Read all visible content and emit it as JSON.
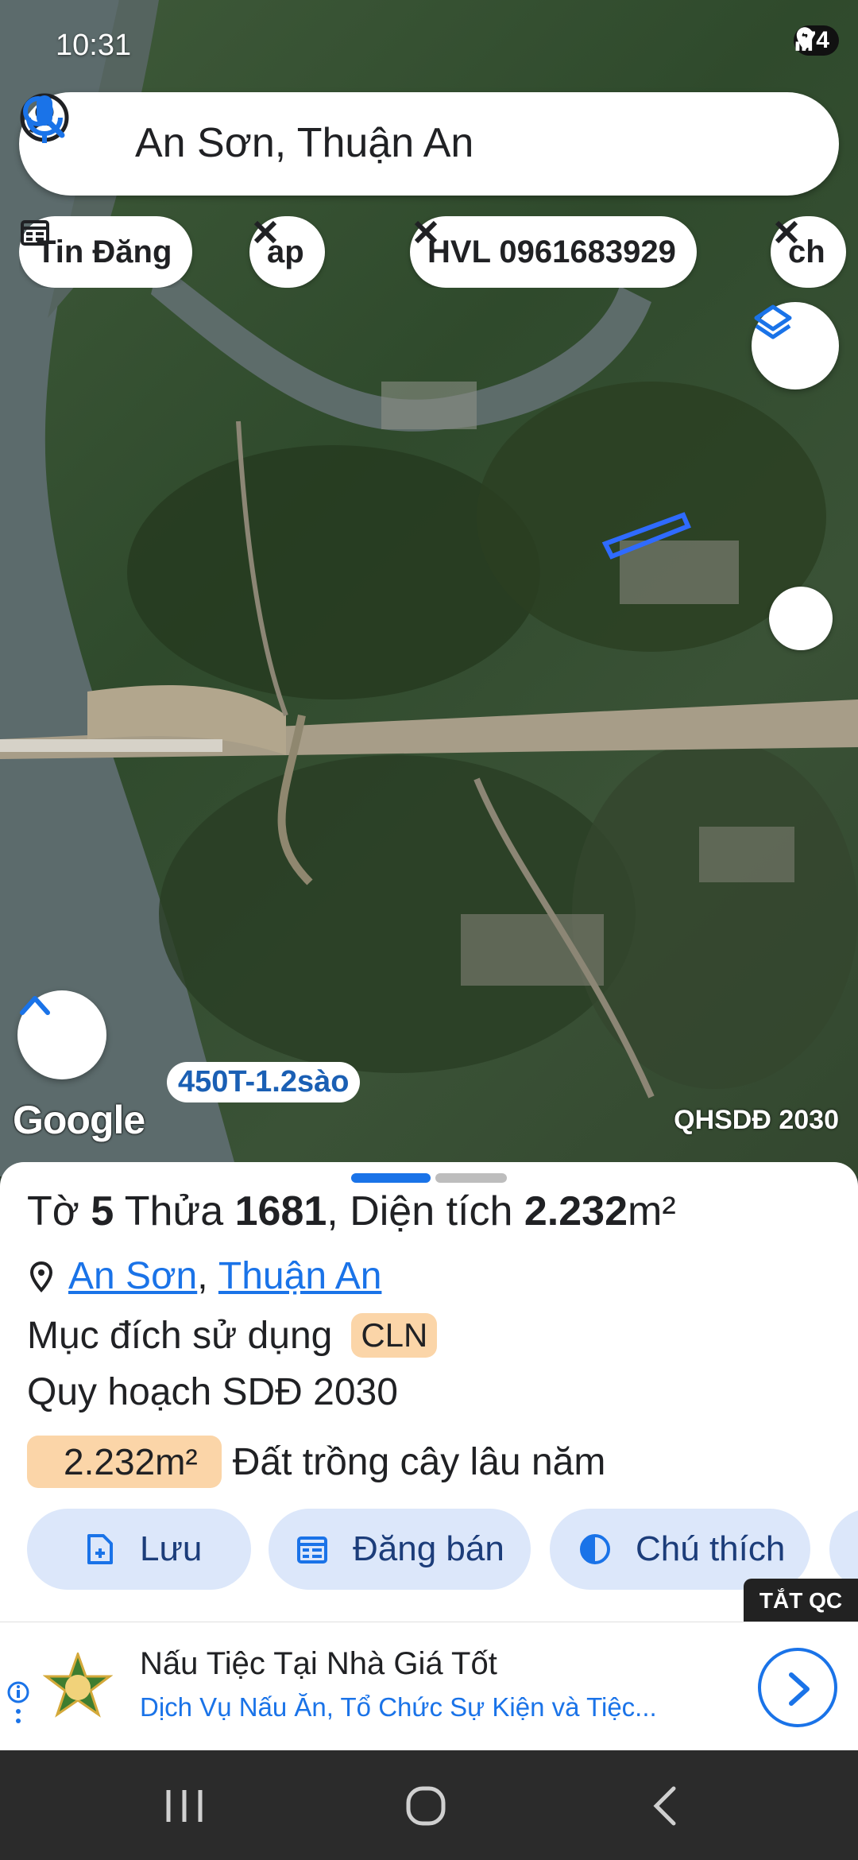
{
  "status_bar": {
    "time": "10:31",
    "battery": "74"
  },
  "search": {
    "query": "An Sơn, Thuận An"
  },
  "chips": [
    {
      "label": "Tin Đăng",
      "icon": "calendar-icon"
    },
    {
      "label": "ap",
      "icon": "tools-icon"
    },
    {
      "label": "HVL 0961683929",
      "icon": "tools-icon"
    },
    {
      "label": "ch",
      "icon": "tools-icon"
    }
  ],
  "map": {
    "parcel_label": "450T-1.2sào",
    "logo": "Google",
    "overlay_caption": "QHSDĐ 2030"
  },
  "parcel": {
    "sheet_prefix": "Tờ ",
    "sheet_no": "5",
    "plot_prefix": " Thửa ",
    "plot_no": "1681",
    "area_prefix": ", Diện tích ",
    "area_value": "2.232",
    "area_unit": "m²",
    "ward": "An Sơn",
    "separator": ", ",
    "district": "Thuận An",
    "purpose_label": "Mục đích sử dụng",
    "purpose_code": "CLN",
    "plan_label": "Quy hoạch SDĐ 2030",
    "plan_area": "2.232m²",
    "plan_land_type": "Đất trồng cây lâu năm"
  },
  "actions": [
    {
      "label": "Lưu",
      "icon": "add-file-icon"
    },
    {
      "label": "Đăng bán",
      "icon": "calendar-icon"
    },
    {
      "label": "Chú thích",
      "icon": "half-circle-icon"
    }
  ],
  "ad_toggle": "TẮT QC",
  "ad": {
    "title": "Nấu Tiệc Tại Nhà Giá Tốt",
    "subtitle": "Dịch Vụ Nấu Ăn, Tổ Chức Sự Kiện và Tiệc..."
  },
  "colors": {
    "accent": "#1a73e8",
    "badge": "#fbd5a8",
    "action_bg": "#dce7fa"
  }
}
